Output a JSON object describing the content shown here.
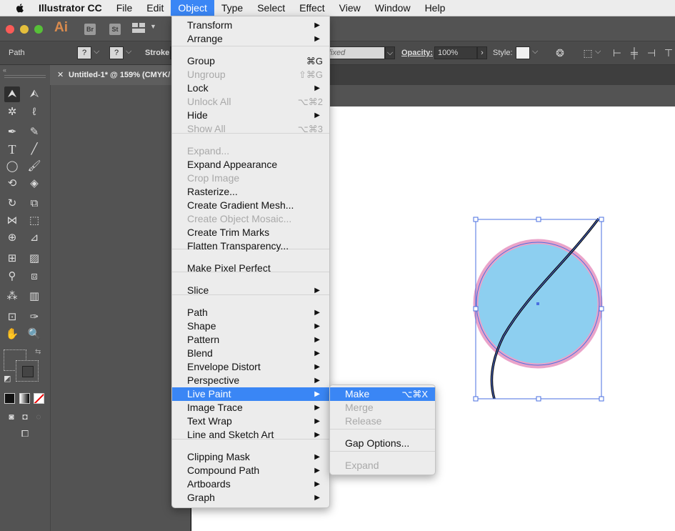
{
  "menubar": {
    "app_name": "Illustrator CC",
    "items": [
      "File",
      "Edit",
      "Object",
      "Type",
      "Select",
      "Effect",
      "View",
      "Window",
      "Help"
    ],
    "active": "Object"
  },
  "appbar": {
    "logo": "Ai",
    "br": "Br",
    "st": "St"
  },
  "controlbar": {
    "selection_type": "Path",
    "stroke_label": "Stroke:",
    "stroke_value": "?",
    "fill_value": "?",
    "profile_value": "fixed",
    "opacity_label": "Opacity:",
    "opacity_value": "100%",
    "style_label": "Style:"
  },
  "document_tab": {
    "title": "Untitled-1* @ 159% (CMYK/"
  },
  "object_menu": {
    "items": [
      {
        "label": "Transform",
        "submenu": true
      },
      {
        "label": "Arrange",
        "submenu": true
      },
      {
        "label": "Group",
        "shortcut": "⌘G"
      },
      {
        "label": "Ungroup",
        "shortcut": "⇧⌘G",
        "disabled": true
      },
      {
        "label": "Lock",
        "submenu": true
      },
      {
        "label": "Unlock All",
        "shortcut": "⌥⌘2",
        "disabled": true
      },
      {
        "label": "Hide",
        "submenu": true
      },
      {
        "label": "Show All",
        "shortcut": "⌥⌘3",
        "disabled": true
      },
      {
        "label": "Expand...",
        "disabled": true
      },
      {
        "label": "Expand Appearance"
      },
      {
        "label": "Crop Image",
        "disabled": true
      },
      {
        "label": "Rasterize..."
      },
      {
        "label": "Create Gradient Mesh..."
      },
      {
        "label": "Create Object Mosaic...",
        "disabled": true
      },
      {
        "label": "Create Trim Marks"
      },
      {
        "label": "Flatten Transparency..."
      },
      {
        "label": "Make Pixel Perfect"
      },
      {
        "label": "Slice",
        "submenu": true
      },
      {
        "label": "Path",
        "submenu": true
      },
      {
        "label": "Shape",
        "submenu": true
      },
      {
        "label": "Pattern",
        "submenu": true
      },
      {
        "label": "Blend",
        "submenu": true
      },
      {
        "label": "Envelope Distort",
        "submenu": true
      },
      {
        "label": "Perspective",
        "submenu": true
      },
      {
        "label": "Live Paint",
        "submenu": true,
        "highlighted": true
      },
      {
        "label": "Image Trace",
        "submenu": true
      },
      {
        "label": "Text Wrap",
        "submenu": true
      },
      {
        "label": "Line and Sketch Art",
        "submenu": true
      },
      {
        "label": "Clipping Mask",
        "submenu": true
      },
      {
        "label": "Compound Path",
        "submenu": true
      },
      {
        "label": "Artboards",
        "submenu": true
      },
      {
        "label": "Graph",
        "submenu": true
      }
    ]
  },
  "live_paint_submenu": {
    "items": [
      {
        "label": "Make",
        "shortcut": "⌥⌘X",
        "highlighted": true
      },
      {
        "label": "Merge",
        "disabled": true
      },
      {
        "label": "Release",
        "disabled": true
      },
      {
        "label": "Gap Options..."
      },
      {
        "label": "Expand",
        "disabled": true
      }
    ]
  },
  "colors": {
    "accent": "#3a86f5",
    "circle_fill": "#8dcff0",
    "circle_stroke": "#e8a0c8",
    "selection": "#4a6fe0"
  }
}
